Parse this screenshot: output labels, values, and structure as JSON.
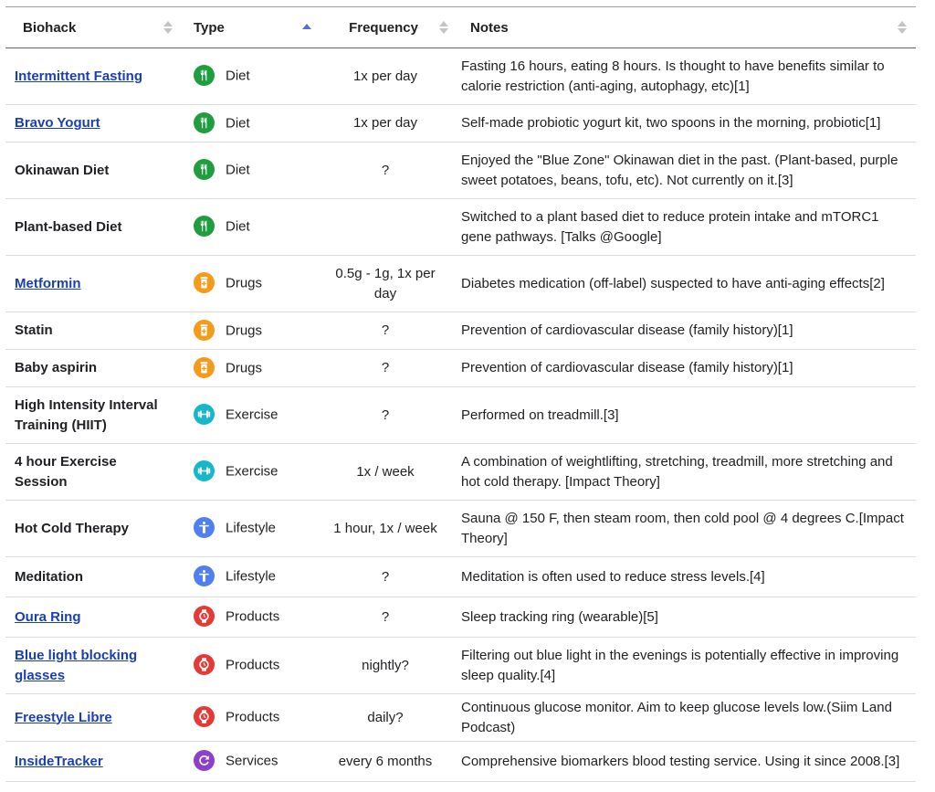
{
  "headers": {
    "biohack": "Biohack",
    "type": "Type",
    "frequency": "Frequency",
    "notes": "Notes"
  },
  "type_colors": {
    "Diet": "#1e9e3e",
    "Drugs": "#f59a1b",
    "Exercise": "#14b8c8",
    "Lifestyle": "#4f7ff0",
    "Products": "#e53935",
    "Services": "#8e3fc8"
  },
  "type_icons": {
    "Diet": "fork-knife-icon",
    "Drugs": "pill-bottle-icon",
    "Exercise": "dumbbell-icon",
    "Lifestyle": "person-icon",
    "Products": "watch-icon",
    "Services": "refresh-icon"
  },
  "rows": [
    {
      "biohack": "Intermittent Fasting",
      "link": true,
      "type": "Diet",
      "frequency": "1x per day",
      "notes": "Fasting 16 hours, eating 8 hours. Is thought to have benefits similar to calorie restriction (anti-aging, autophagy, etc)[1]"
    },
    {
      "biohack": "Bravo Yogurt",
      "link": true,
      "type": "Diet",
      "frequency": "1x per day",
      "notes": "Self-made probiotic yogurt kit, two spoons in the morning, probiotic[1]"
    },
    {
      "biohack": "Okinawan Diet",
      "link": false,
      "type": "Diet",
      "frequency": "?",
      "notes": "Enjoyed the \"Blue Zone\" Okinawan diet in the past. (Plant-based, purple sweet potatoes, beans, tofu, etc). Not currently on it.[3]"
    },
    {
      "biohack": "Plant-based Diet",
      "link": false,
      "type": "Diet",
      "frequency": "",
      "notes": "Switched to a plant based diet to reduce protein intake and mTORC1 gene pathways. [Talks @Google]"
    },
    {
      "biohack": "Metformin",
      "link": true,
      "type": "Drugs",
      "frequency": "0.5g - 1g, 1x per day",
      "notes": "Diabetes medication (off-label) suspected to have anti-aging effects[2]"
    },
    {
      "biohack": "Statin",
      "link": false,
      "type": "Drugs",
      "frequency": "?",
      "notes": "Prevention of cardiovascular disease (family history)[1]"
    },
    {
      "biohack": "Baby aspirin",
      "link": false,
      "type": "Drugs",
      "frequency": "?",
      "notes": "Prevention of cardiovascular disease (family history)[1]"
    },
    {
      "biohack": "High Intensity Interval Training (HIIT)",
      "link": false,
      "type": "Exercise",
      "frequency": "?",
      "notes": "Performed on treadmill.[3]"
    },
    {
      "biohack": "4 hour Exercise Session",
      "link": false,
      "type": "Exercise",
      "frequency": "1x / week",
      "notes": "A combination of weightlifting, stretching, treadmill, more stretching and hot cold therapy. [Impact Theory]"
    },
    {
      "biohack": "Hot Cold Therapy",
      "link": false,
      "type": "Lifestyle",
      "frequency": "1 hour, 1x / week",
      "notes": "Sauna @ 150 F, then steam room, then cold pool @ 4 degrees C.[Impact Theory]"
    },
    {
      "biohack": "Meditation",
      "link": false,
      "type": "Lifestyle",
      "frequency": "?",
      "notes": "Meditation is often used to reduce stress levels.[4]"
    },
    {
      "biohack": "Oura Ring",
      "link": true,
      "type": "Products",
      "frequency": "?",
      "notes": "Sleep tracking ring (wearable)[5]"
    },
    {
      "biohack": "Blue light blocking glasses",
      "link": true,
      "type": "Products",
      "frequency": "nightly?",
      "notes": "Filtering out blue light in the evenings is potentially effective in improving sleep quality.[4]"
    },
    {
      "biohack": "Freestyle Libre",
      "link": true,
      "type": "Products",
      "frequency": "daily?",
      "notes": "Continuous glucose monitor. Aim to keep glucose levels low.(Siim Land Podcast)"
    },
    {
      "biohack": "InsideTracker",
      "link": true,
      "type": "Services",
      "frequency": "every 6 months",
      "notes": "Comprehensive biomarkers blood testing service. Using it since 2008.[3]"
    }
  ]
}
